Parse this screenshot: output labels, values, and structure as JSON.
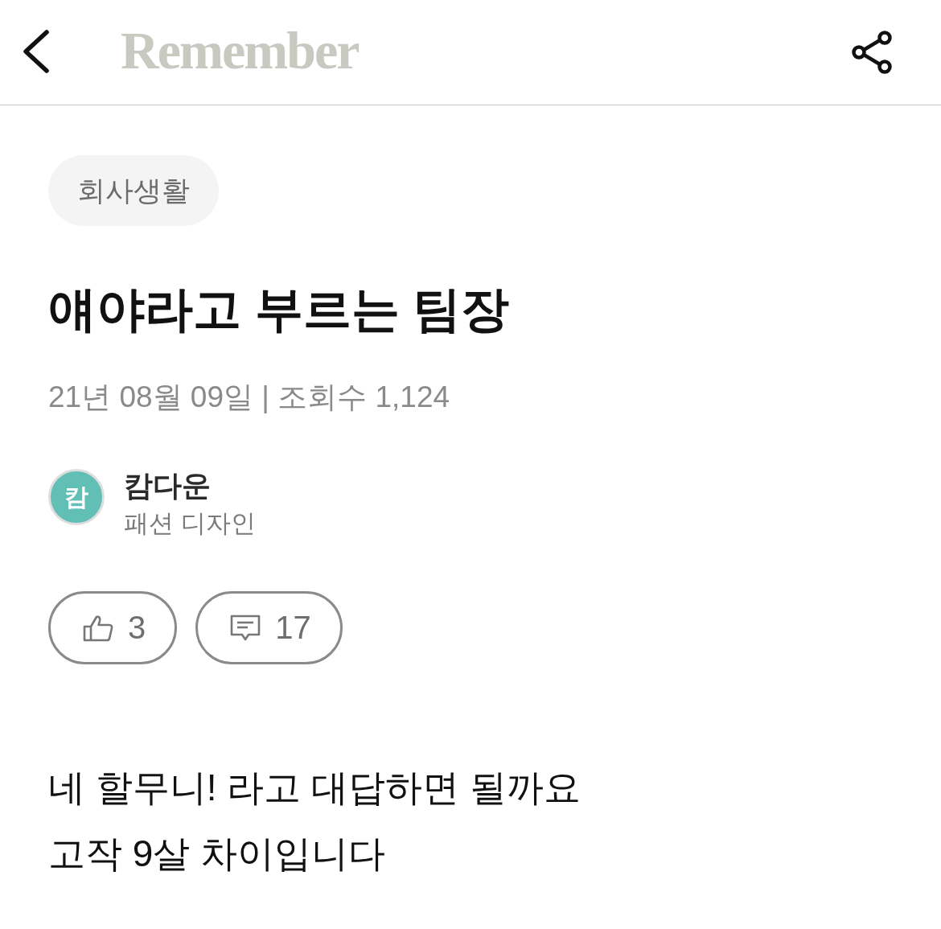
{
  "header": {
    "logo": "Remember"
  },
  "category": {
    "label": "회사생활"
  },
  "post": {
    "title": "얘야라고 부르는 팀장",
    "meta": "21년 08월 09일 | 조회수 1,124"
  },
  "author": {
    "initial": "캄",
    "name": "캄다운",
    "job": "패션 디자인"
  },
  "reactions": [
    {
      "kind": "like",
      "count": "3"
    },
    {
      "kind": "comment",
      "count": "17"
    }
  ],
  "body": [
    "네 할무니! 라고 대답하면 될까요",
    "고작 9살 차이입니다"
  ]
}
